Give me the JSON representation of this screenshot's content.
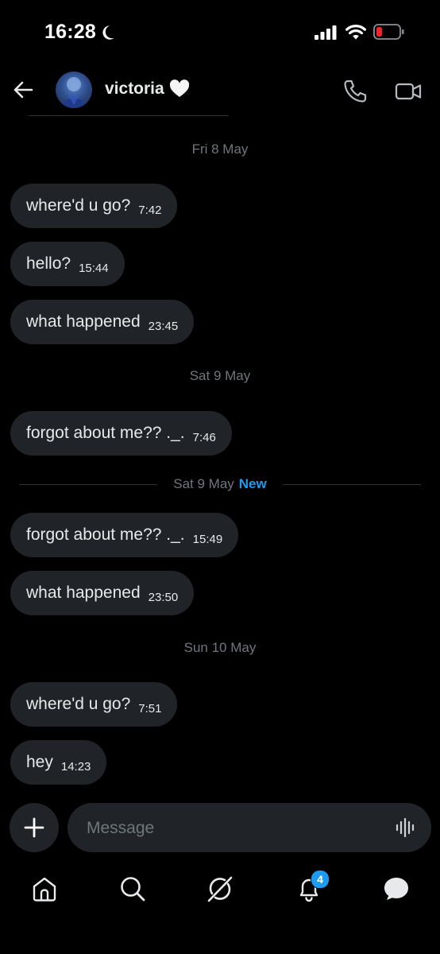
{
  "status_bar": {
    "time": "16:28",
    "icons": [
      "moon-icon",
      "signal-icon",
      "wifi-icon",
      "battery-icon"
    ]
  },
  "header": {
    "contact_name": "victoria",
    "name_emoji": "🤍",
    "icons": [
      "back-arrow-icon",
      "phone-icon",
      "video-icon"
    ]
  },
  "conversation": {
    "groups": [
      {
        "date": "Fri 8 May",
        "messages": [
          {
            "text": "where'd u go?",
            "time": "7:42"
          },
          {
            "text": "hello?",
            "time": "15:44"
          },
          {
            "text": "what happened",
            "time": "23:45"
          }
        ]
      },
      {
        "date": "Sat 9 May",
        "messages": [
          {
            "text": "forgot about me?? ._.",
            "time": "7:46"
          }
        ]
      },
      {
        "date": "Sat 9 May",
        "new_label": "New",
        "messages": [
          {
            "text": "forgot about me?? ._.",
            "time": "15:49"
          },
          {
            "text": "what happened",
            "time": "23:50"
          }
        ]
      },
      {
        "date": "Sun 10 May",
        "messages": [
          {
            "text": "where'd u go?",
            "time": "7:51"
          },
          {
            "text": "hey",
            "time": "14:23"
          }
        ]
      }
    ]
  },
  "composer": {
    "placeholder": "Message",
    "icons": [
      "plus-icon",
      "voice-wave-icon"
    ]
  },
  "bottom_nav": {
    "items": [
      "home-icon",
      "search-icon",
      "grok-icon",
      "bell-icon",
      "messages-icon"
    ],
    "notification_count": "4"
  },
  "colors": {
    "background": "#000000",
    "bubble": "#202327",
    "muted_text": "#71767b",
    "accent": "#1d9bf0",
    "battery_low": "#f4212e"
  }
}
